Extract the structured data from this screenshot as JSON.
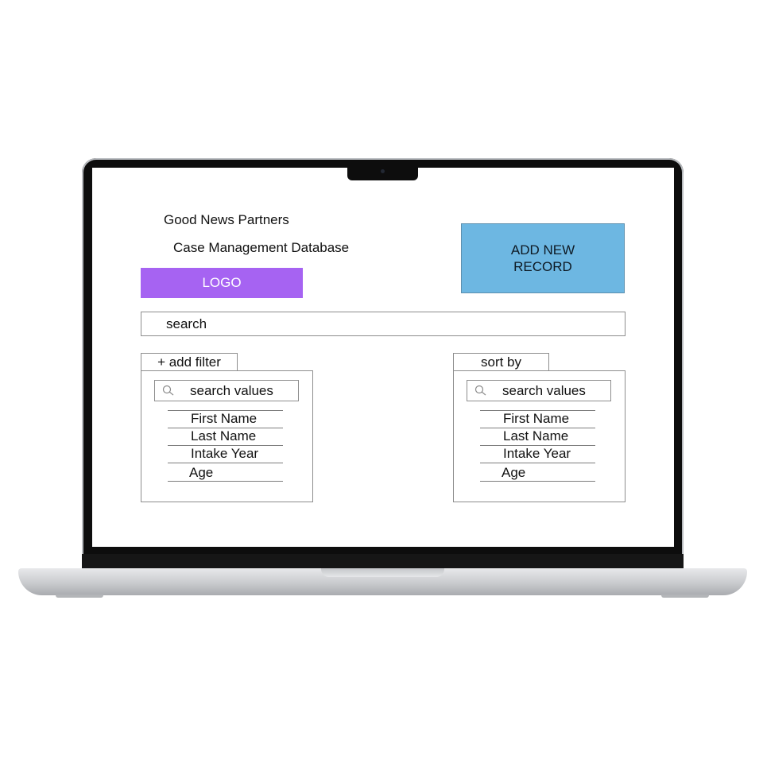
{
  "header": {
    "org_name": "Good News Partners",
    "app_name": "Case Management Database",
    "logo_label": "LOGO"
  },
  "actions": {
    "add_record_label": "ADD NEW RECORD"
  },
  "search": {
    "placeholder": "search"
  },
  "filter_panel": {
    "tab_label": "+ add filter",
    "search_placeholder": "search values",
    "options": [
      "First Name",
      "Last Name",
      "Intake Year",
      "Age"
    ]
  },
  "sort_panel": {
    "tab_label": "sort by",
    "search_placeholder": "search values",
    "options": [
      "First Name",
      "Last Name",
      "Intake Year",
      "Age"
    ]
  },
  "colors": {
    "logo_bg": "#a663f2",
    "add_button_bg": "#6db7e2"
  },
  "icons": {
    "panel_search": "search-icon"
  }
}
